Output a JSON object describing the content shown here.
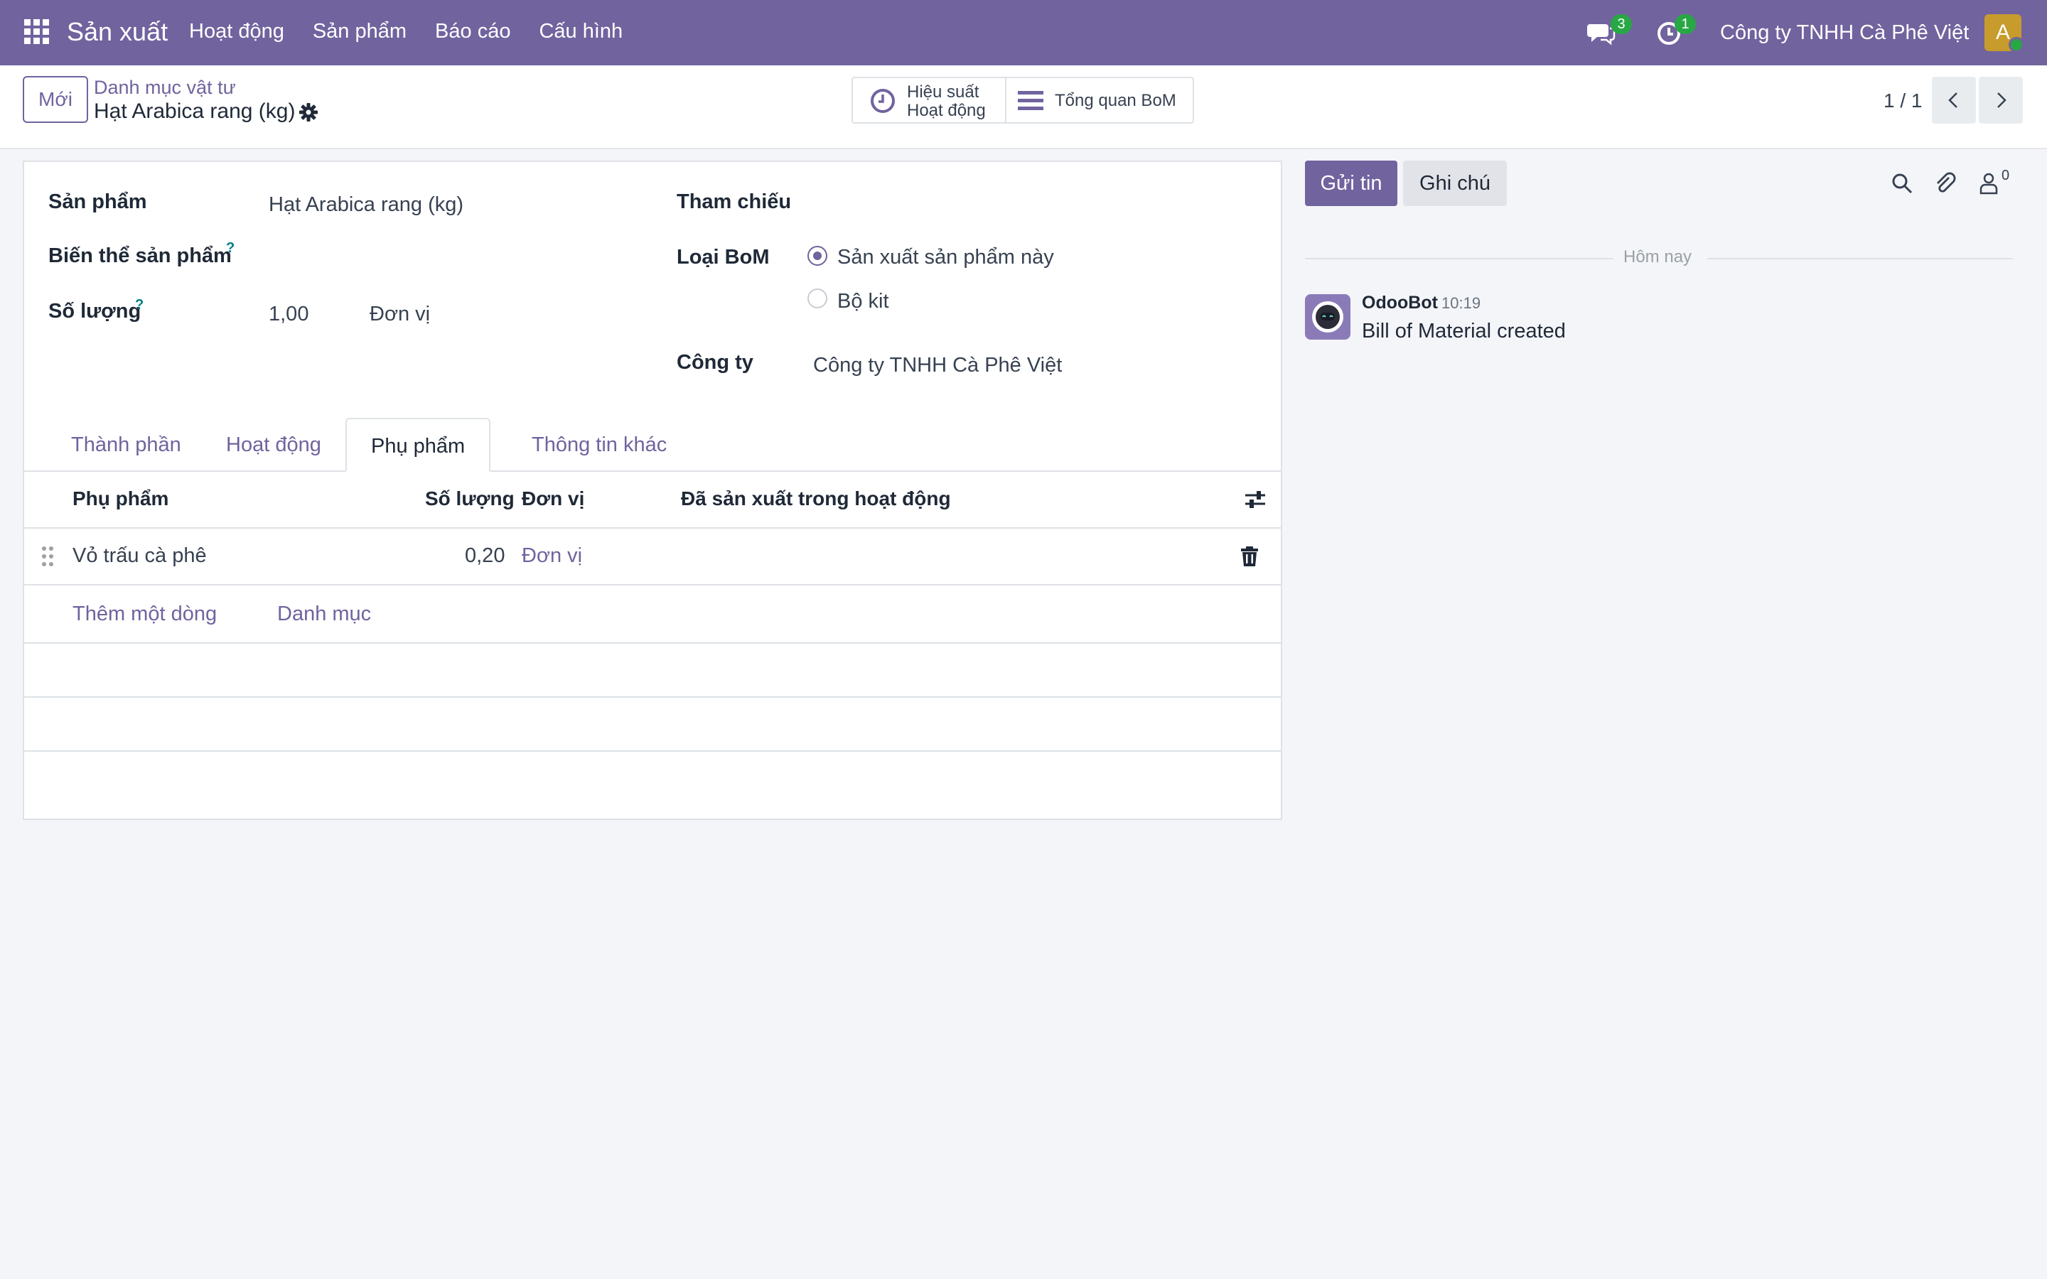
{
  "navbar": {
    "app_name": "Sản xuất",
    "menu": [
      "Hoạt động",
      "Sản phẩm",
      "Báo cáo",
      "Cấu hình"
    ],
    "messages_count": "3",
    "activities_count": "1",
    "company": "Công ty TNHH Cà Phê Việt",
    "avatar_letter": "A"
  },
  "control": {
    "new_label": "Mới",
    "breadcrumb_parent": "Danh mục vật tư",
    "record_title": "Hạt Arabica rang (kg)",
    "smart_buttons": {
      "performance_line1": "Hiệu suất",
      "performance_line2": "Hoạt động",
      "overview": "Tổng quan BoM"
    },
    "pager": "1 / 1"
  },
  "form": {
    "product_label": "Sản phẩm",
    "product_value": "Hạt Arabica rang (kg)",
    "variant_label": "Biến thể sản phẩm",
    "help_mark": "?",
    "quantity_label": "Số lượng",
    "quantity_value": "1,00",
    "quantity_uom": "Đơn vị",
    "reference_label": "Tham chiếu",
    "bom_type_label": "Loại BoM",
    "bom_type_options": [
      "Sản xuất sản phẩm này",
      "Bộ kit"
    ],
    "bom_type_selected": "Sản xuất sản phẩm này",
    "company_label": "Công ty",
    "company_value": "Công ty TNHH Cà Phê Việt"
  },
  "tabs": [
    "Thành phần",
    "Hoạt động",
    "Phụ phẩm",
    "Thông tin khác"
  ],
  "active_tab": "Phụ phẩm",
  "byproducts_table": {
    "columns": [
      "Phụ phẩm",
      "Số lượng",
      "Đơn vị",
      "Đã sản xuất trong hoạt động"
    ],
    "rows": [
      {
        "product": "Vỏ trấu cà phê",
        "quantity": "0,20",
        "uom": "Đơn vị",
        "operation": ""
      }
    ],
    "add_line": "Thêm một dòng",
    "catalog": "Danh mục"
  },
  "chatter": {
    "send_label": "Gửi tin",
    "note_label": "Ghi chú",
    "followers_count": "0",
    "date_separator": "Hôm nay",
    "messages": [
      {
        "author": "OdooBot",
        "time": "10:19",
        "body": "Bill of Material created"
      }
    ]
  },
  "colors": {
    "brand": "#71639e",
    "badge": "#28a745",
    "background": "#f4f5f8"
  }
}
